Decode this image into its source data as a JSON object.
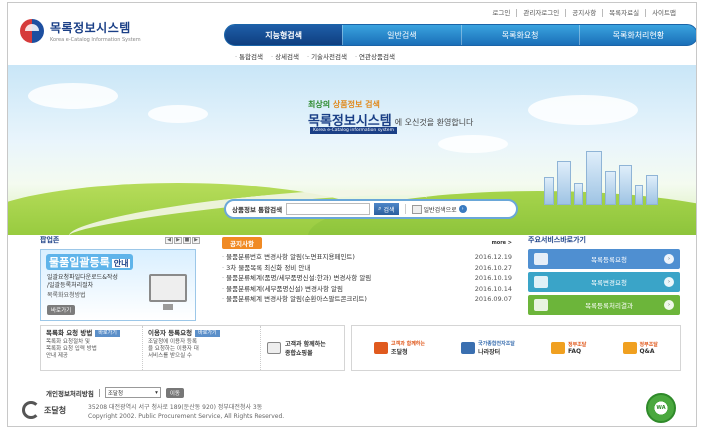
{
  "utility_links": [
    "로그인",
    "관리자로그인",
    "공지사항",
    "목록자료실",
    "사이트맵"
  ],
  "logo": {
    "title": "목록정보시스템",
    "subtitle": "Korea e-Catalog Information System"
  },
  "nav": {
    "items": [
      {
        "label": "지능형검색",
        "active": true
      },
      {
        "label": "일반검색",
        "active": false
      },
      {
        "label": "목록화요청",
        "active": false
      },
      {
        "label": "목록화처리현황",
        "active": false
      }
    ],
    "sub_items": [
      "통합검색",
      "상세검색",
      "기술사전검색",
      "연관상품검색"
    ]
  },
  "hero": {
    "slogan_prefix": "최상의 ",
    "slogan_highlight": "상품정보 검색",
    "brand": "목록정보시스템",
    "welcome": "에 오신것을 환영합니다",
    "tag": "Korea e-Catalog information system"
  },
  "search": {
    "label": "상품정보 통합검색",
    "value": "",
    "button": "검색",
    "advanced": "일반검색으로"
  },
  "popup": {
    "title": "팝업존",
    "controls": [
      "◀",
      "▶",
      "■",
      "▶"
    ],
    "banner_title": "물품일괄등록",
    "banner_suffix": "안내",
    "line1": "일괄요청파일다운로드&작성",
    "line2": "/일괄등록처리절차",
    "line3": "목록화요청방법",
    "more": "바로가기"
  },
  "notice": {
    "tab": "공지사항",
    "more": "more >",
    "items": [
      {
        "text": "물품분류번호 변경사항 알림(노면표지용페인트)",
        "date": "2016.12.19"
      },
      {
        "text": "3차 물품목록 최신화 정비 안내",
        "date": "2016.10.27"
      },
      {
        "text": "물품분류체계(품명/세부품명신설:한과) 변경사항 알림",
        "date": "2016.10.19"
      },
      {
        "text": "물품분류체계(세부품명신설) 변경사항 알림",
        "date": "2016.10.14"
      },
      {
        "text": "물품분류체계 변경사항 알림(순환아스팔트콘크리트)",
        "date": "2016.09.07"
      }
    ]
  },
  "shortcuts": {
    "title": "주요서비스바로가기",
    "items": [
      {
        "label": "목록등록요청",
        "color": "#4f8fd1"
      },
      {
        "label": "목록변경요청",
        "color": "#3aa4c8"
      },
      {
        "label": "목록등록처리결과",
        "color": "#6cb53a"
      }
    ]
  },
  "info_left": {
    "col1_title": "목록화 요청 방법",
    "col1_badge": "바로가기",
    "col1_text": [
      "목록화 요청절차 및",
      "목록화 요청 입력 방법",
      "안내 제공"
    ],
    "col2_title": "이용자 등록요청",
    "col2_badge": "바로가기",
    "col2_text": [
      "조달청에 이용자 등록",
      "을 요청하는 이용자 대",
      "서비스를 받으실 수"
    ],
    "cart_l1": "고객과 함께하는",
    "cart_l2": "종합쇼핑몰"
  },
  "info_right": [
    {
      "line1": "고객과 함께하는",
      "line2": "조달청",
      "color": "#e05a1e"
    },
    {
      "line1": "국가종합전자조달",
      "line2": "나라장터",
      "color": "#3a6fb0"
    },
    {
      "line1": "정부조달",
      "line2": "FAQ",
      "color": "#f0a020"
    },
    {
      "line1": "정부조달",
      "line2": "Q&A",
      "color": "#f0a020"
    }
  ],
  "footer": {
    "policy": "개인정보처리방침",
    "select_value": "조달청",
    "go": "이동",
    "org": "조달청",
    "address": "35208 대전광역시 서구 청사로 189(둔산동 920) 정부대전청사 3동",
    "copyright": "Copyright 2002. Public Procurement Service, All Rights Reserved.",
    "badge": "WA"
  }
}
